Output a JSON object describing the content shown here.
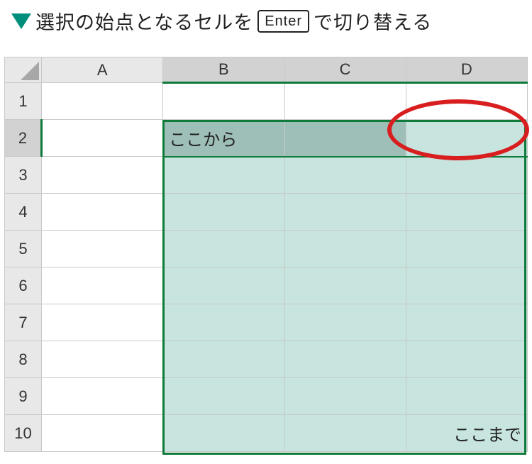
{
  "title": {
    "marker": "▼",
    "before_key": "選択の始点となるセルを",
    "key_label": "Enter",
    "after_key": "で切り替える"
  },
  "sheet": {
    "columns": [
      "A",
      "B",
      "C",
      "D"
    ],
    "rows": [
      "1",
      "2",
      "3",
      "4",
      "5",
      "6",
      "7",
      "8",
      "9",
      "10"
    ],
    "selection": {
      "from": "B2",
      "to": "D10",
      "active_cell": "D2"
    },
    "cells": {
      "B2": "ここから",
      "D10": "ここまで"
    }
  },
  "colors": {
    "accent": "#0e7b3a",
    "sel_fill": "#c7e4de",
    "annotation": "#d81e1e"
  }
}
